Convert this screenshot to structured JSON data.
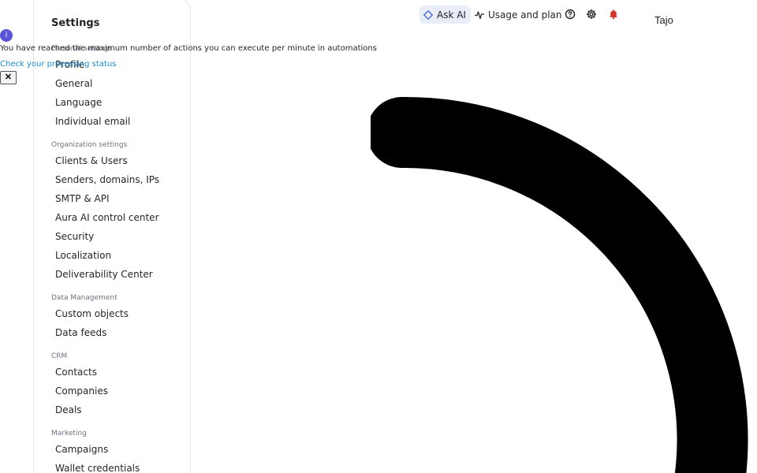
{
  "sidebar": {
    "title": "Settings",
    "sections": [
      {
        "heading": "Personal settings",
        "items": [
          "Profile",
          "General",
          "Language",
          "Individual email"
        ]
      },
      {
        "heading": "Organization settings",
        "items": [
          "Clients & Users",
          "Senders, domains, IPs",
          "SMTP & API",
          "Aura AI control center",
          "Security",
          "Localization",
          "Deliverability Center"
        ]
      },
      {
        "heading": "Data Management",
        "items": [
          "Custom objects",
          "Data feeds"
        ]
      },
      {
        "heading": "CRM",
        "items": [
          "Contacts",
          "Companies",
          "Deals"
        ]
      },
      {
        "heading": "Marketing",
        "items": [
          "Campaigns",
          "Wallet credentials"
        ]
      }
    ]
  },
  "header": {
    "ask_ai_label": "Ask AI",
    "usage_label": "Usage and plan",
    "user_name": "Tajo"
  },
  "notice": {
    "message": "You have reached the maximum number of actions you can execute per minute in automations",
    "link": "Check your processing status",
    "close_label": "✕"
  },
  "icons": {
    "ask_ai": "sparkle-diamond-icon",
    "usage": "activity-pulse-icon",
    "help": "help-circle-icon",
    "settings": "gear-icon",
    "notifications": "bell-icon",
    "info": "info-icon",
    "loader": "loading-spinner-arc"
  },
  "colors": {
    "ask_ai_bg": "#e8edf7",
    "info_icon": "#5a55d6",
    "link": "#1a8ccf",
    "bell": "#d9342b"
  }
}
